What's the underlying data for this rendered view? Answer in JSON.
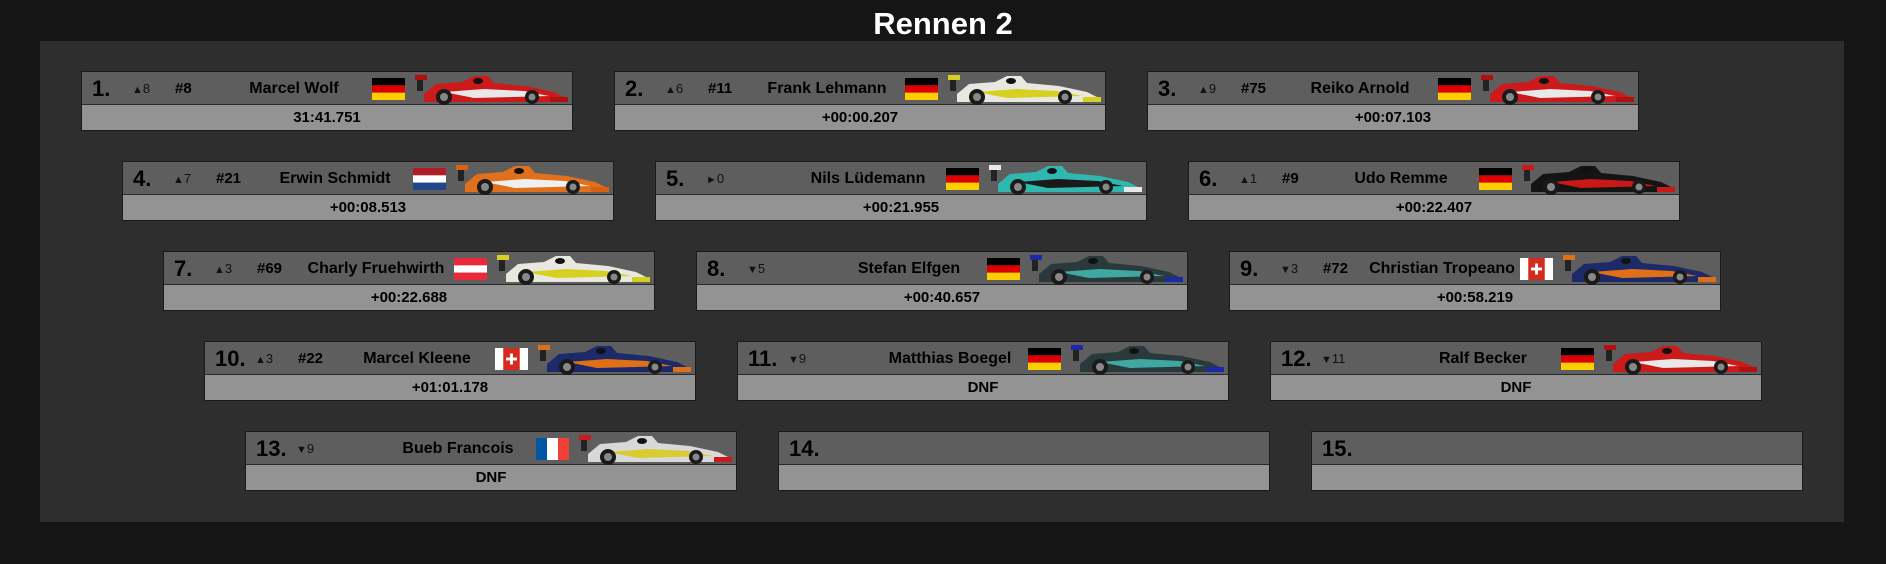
{
  "title": "Rennen 2",
  "results": [
    {
      "pos": "1.",
      "dir": "up",
      "change": "8",
      "num": "#8",
      "name": "Marcel Wolf",
      "flag": "de",
      "car": "red",
      "time": "31:41.751"
    },
    {
      "pos": "2.",
      "dir": "up",
      "change": "6",
      "num": "#11",
      "name": "Frank Lehmann",
      "flag": "de",
      "car": "yellow",
      "time": "+00:00.207"
    },
    {
      "pos": "3.",
      "dir": "up",
      "change": "9",
      "num": "#75",
      "name": "Reiko Arnold",
      "flag": "de",
      "car": "red",
      "time": "+00:07.103"
    },
    {
      "pos": "4.",
      "dir": "up",
      "change": "7",
      "num": "#21",
      "name": "Erwin Schmidt",
      "flag": "nl",
      "car": "orange",
      "time": "+00:08.513"
    },
    {
      "pos": "5.",
      "dir": "same",
      "change": "0",
      "num": "",
      "name": "Nils Lüdemann",
      "flag": "de",
      "car": "teal",
      "time": "+00:21.955"
    },
    {
      "pos": "6.",
      "dir": "up",
      "change": "1",
      "num": "#9",
      "name": "Udo Remme",
      "flag": "de",
      "car": "black",
      "time": "+00:22.407"
    },
    {
      "pos": "7.",
      "dir": "up",
      "change": "3",
      "num": "#69",
      "name": "Charly Fruehwirth",
      "flag": "at",
      "car": "yellow",
      "time": "+00:22.688"
    },
    {
      "pos": "8.",
      "dir": "down",
      "change": "5",
      "num": "",
      "name": "Stefan Elfgen",
      "flag": "de",
      "car": "darkteal",
      "time": "+00:40.657"
    },
    {
      "pos": "9.",
      "dir": "down",
      "change": "3",
      "num": "#72",
      "name": "Christian Tropeano",
      "flag": "ch",
      "car": "navy",
      "time": "+00:58.219"
    },
    {
      "pos": "10.",
      "dir": "up",
      "change": "3",
      "num": "#22",
      "name": "Marcel Kleene",
      "flag": "ch",
      "car": "navy",
      "time": "+01:01.178"
    },
    {
      "pos": "11.",
      "dir": "down",
      "change": "9",
      "num": "",
      "name": "Matthias Boegel",
      "flag": "de",
      "car": "darkteal",
      "time": "DNF"
    },
    {
      "pos": "12.",
      "dir": "down",
      "change": "11",
      "num": "",
      "name": "Ralf Becker",
      "flag": "de",
      "car": "red",
      "time": "DNF"
    },
    {
      "pos": "13.",
      "dir": "down",
      "change": "9",
      "num": "",
      "name": "Bueb Francois",
      "flag": "fr",
      "car": "silver",
      "time": "DNF"
    },
    {
      "pos": "14.",
      "dir": "",
      "change": "",
      "num": "",
      "name": "",
      "flag": "",
      "car": "",
      "time": ""
    },
    {
      "pos": "15.",
      "dir": "",
      "change": "",
      "num": "",
      "name": "",
      "flag": "",
      "car": "",
      "time": ""
    }
  ],
  "arrows": {
    "up": "▲",
    "down": "▼",
    "same": "►"
  },
  "car_colors": {
    "red": {
      "body": "#cc1a1a",
      "accent": "#e8e8e8",
      "wing": "#b01010"
    },
    "yellow": {
      "body": "#e8e8e0",
      "accent": "#d8d020",
      "wing": "#d8d020"
    },
    "orange": {
      "body": "#e0701c",
      "accent": "#f0f0f0",
      "wing": "#d86010"
    },
    "teal": {
      "body": "#2fb8b0",
      "accent": "#1a1a1a",
      "wing": "#e8e8e8"
    },
    "black": {
      "body": "#141414",
      "accent": "#c81818",
      "wing": "#c81818"
    },
    "darkteal": {
      "body": "#2a3a3c",
      "accent": "#3fa8a0",
      "wing": "#1a2aa8"
    },
    "navy": {
      "body": "#1c2a6a",
      "accent": "#e07018",
      "wing": "#e07018"
    },
    "silver": {
      "body": "#d8d8d8",
      "accent": "#d8cc30",
      "wing": "#cc1a1a"
    }
  }
}
